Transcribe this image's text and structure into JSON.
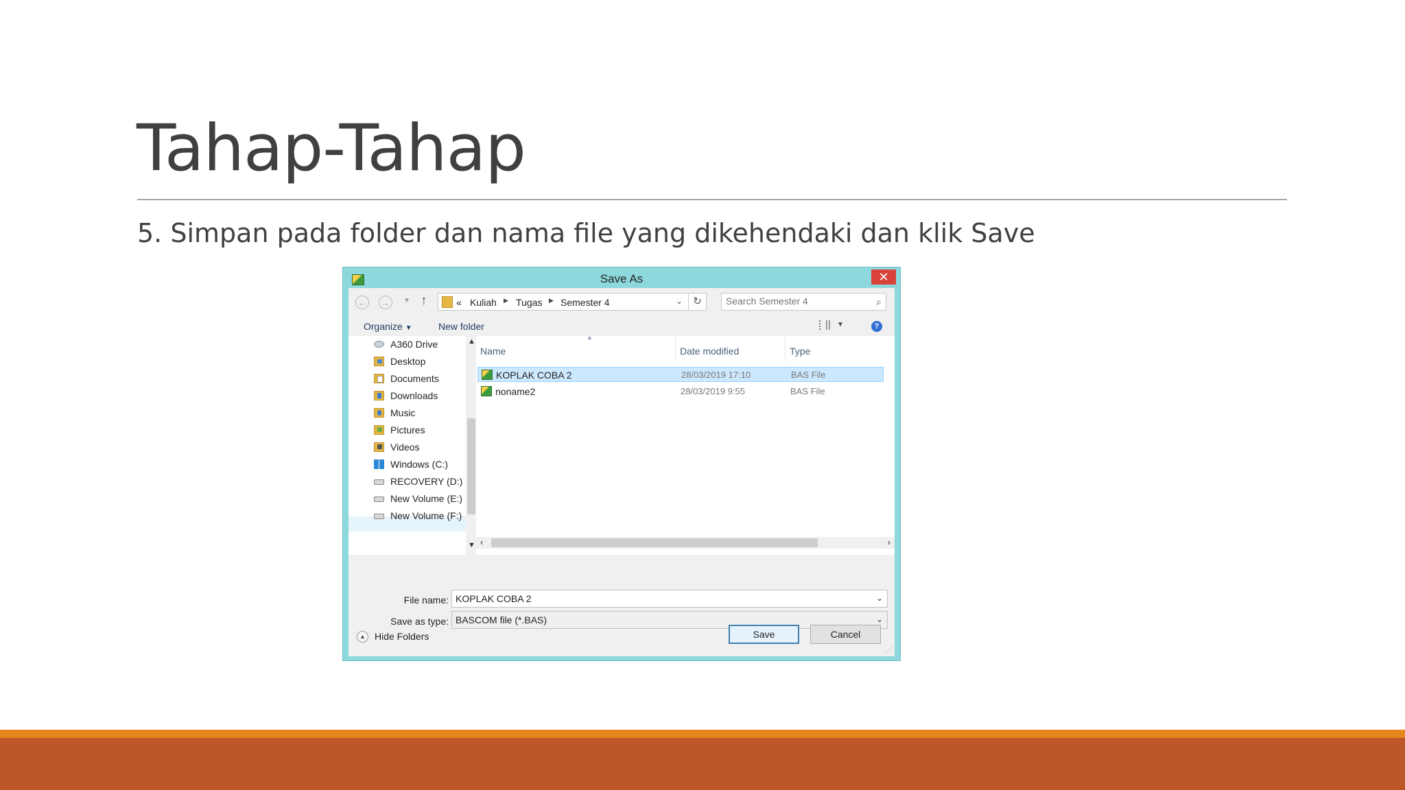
{
  "slide": {
    "title": "Tahap-Tahap",
    "body": "5. Simpan pada folder dan nama file yang dikehendaki dan klik Save"
  },
  "dialog": {
    "title": "Save As",
    "close_label": "✕",
    "address": {
      "overflow": "«",
      "crumbs": [
        "Kuliah",
        "Tugas",
        "Semester 4"
      ]
    },
    "search_placeholder": "Search Semester 4",
    "toolbar": {
      "organize": "Organize",
      "new_folder": "New folder"
    },
    "nav_items": [
      {
        "label": "A360 Drive",
        "icon": "cloud-drive-icon"
      },
      {
        "label": "Desktop",
        "icon": "desktop-folder-icon"
      },
      {
        "label": "Documents",
        "icon": "documents-folder-icon"
      },
      {
        "label": "Downloads",
        "icon": "downloads-folder-icon"
      },
      {
        "label": "Music",
        "icon": "music-folder-icon"
      },
      {
        "label": "Pictures",
        "icon": "pictures-folder-icon"
      },
      {
        "label": "Videos",
        "icon": "videos-folder-icon"
      },
      {
        "label": "Windows (C:)",
        "icon": "windows-drive-icon"
      },
      {
        "label": "RECOVERY (D:)",
        "icon": "hard-drive-icon"
      },
      {
        "label": "New Volume (E:)",
        "icon": "hard-drive-icon"
      },
      {
        "label": "New Volume (F:)",
        "icon": "hard-drive-icon"
      }
    ],
    "columns": {
      "name": "Name",
      "date": "Date modified",
      "type": "Type"
    },
    "files": [
      {
        "name": "KOPLAK COBA 2",
        "date": "28/03/2019 17:10",
        "type": "BAS File",
        "selected": true
      },
      {
        "name": "noname2",
        "date": "28/03/2019 9:55",
        "type": "BAS File",
        "selected": false
      }
    ],
    "file_name_label": "File name:",
    "file_name_value": "KOPLAK COBA 2",
    "save_type_label": "Save as type:",
    "save_type_value": "BASCOM file (*.BAS)",
    "hide_folders": "Hide Folders",
    "save_button": "Save",
    "cancel_button": "Cancel"
  },
  "colors": {
    "title_text": "#404040",
    "dialog_frame": "#8dd8dc",
    "close_button": "#d9423a",
    "selection": "#cce8ff",
    "footer_stripe": "#e4861c",
    "footer_band": "#bd5628"
  }
}
